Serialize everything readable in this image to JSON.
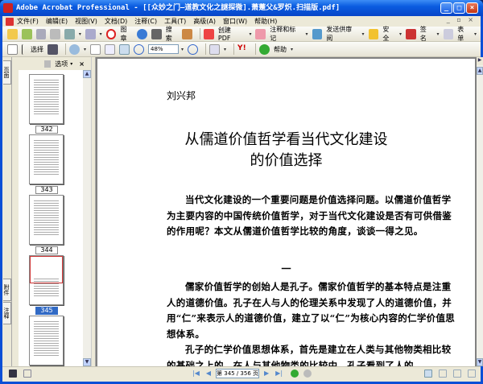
{
  "window": {
    "title": "Adobe Acrobat Professional - [[众妙之门—道教文化之謎探微].萧萐父&罗炽.扫描版.pdf]"
  },
  "menu": [
    "文件(F)",
    "编辑(E)",
    "视图(V)",
    "文档(D)",
    "注释(C)",
    "工具(T)",
    "高级(A)",
    "窗口(W)",
    "帮助(H)"
  ],
  "toolbar1": {
    "stamp": "图章",
    "search": "搜索",
    "create_pdf": "创建 PDF",
    "comment": "注释和标记",
    "review": "发送供审阅",
    "secure": "安全",
    "sign": "签名",
    "forms": "表单"
  },
  "toolbar2": {
    "select": "选择",
    "zoom": "48%",
    "help": "帮助"
  },
  "left_tabs": [
    "页面",
    "附件",
    "注释"
  ],
  "panel": {
    "options": "选项",
    "close": "×",
    "thumbnails": [
      {
        "label": "342",
        "selected": false
      },
      {
        "label": "343",
        "selected": false
      },
      {
        "label": "344",
        "selected": false
      },
      {
        "label": "345",
        "selected": true
      }
    ]
  },
  "document": {
    "author": "刘兴邦",
    "title_line1": "从儒道价值哲学看当代文化建设",
    "title_line2": "的价值选择",
    "para1": "当代文化建设的一个重要问题是价值选择问题。以儒道价值哲学为主要内容的中国传统价值哲学，对于当代文化建设是否有可供借鉴的作用呢？本文从儒道价值哲学比较的角度，谈谈一得之见。",
    "section": "一",
    "para2": "儒家价值哲学的创始人是孔子。儒家价值哲学的基本特点是注重人的道德价值。孔子在人与人的伦理关系中发现了人的道德价值，并用“仁”来表示人的道德价值，建立了以“仁”为核心内容的仁学价值思想体系。",
    "para3": "孔子的仁学价值思想体系，首先是建立在人类与其他物类相比较的基础之上的。在人与其他物类的比较中，孔子看到了人的"
  },
  "status": {
    "page_display": "第 345 / 356 页",
    "current_page": 345,
    "total_pages": 356
  }
}
